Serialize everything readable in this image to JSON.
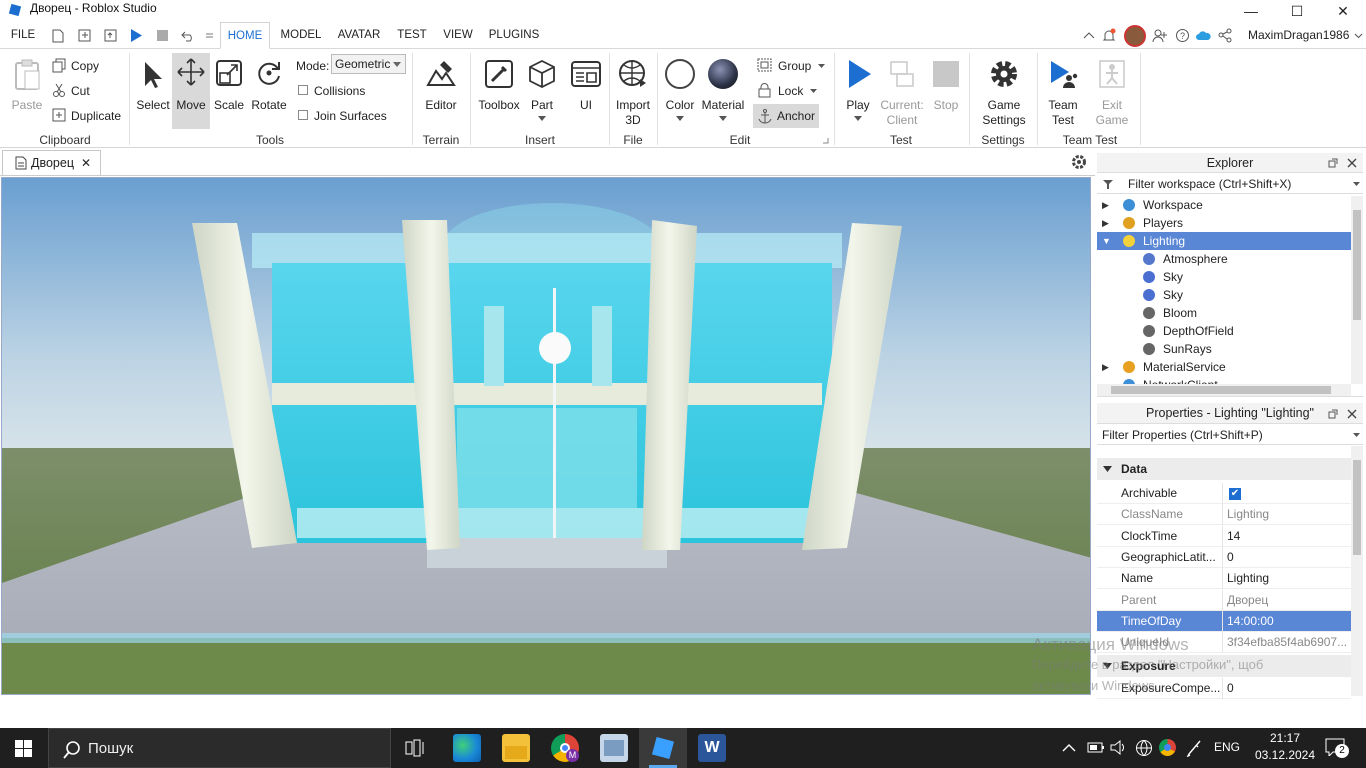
{
  "window": {
    "title": "Дворец - Roblox Studio",
    "minimize": "—",
    "maximize": "☐",
    "close": "✕"
  },
  "menu": {
    "tabs": [
      "FILE",
      "HOME",
      "MODEL",
      "AVATAR",
      "TEST",
      "VIEW",
      "PLUGINS"
    ],
    "active": "HOME",
    "username": "MaximDragan1986"
  },
  "ribbon": {
    "clipboard": {
      "paste": "Paste",
      "copy": "Copy",
      "cut": "Cut",
      "duplicate": "Duplicate",
      "group_label": "Clipboard"
    },
    "tools": {
      "select": "Select",
      "move": "Move",
      "scale": "Scale",
      "rotate": "Rotate",
      "mode_label": "Mode:",
      "mode_value": "Geometric",
      "collisions": "Collisions",
      "join_surfaces": "Join Surfaces",
      "group_label": "Tools"
    },
    "terrain": {
      "editor": "Editor",
      "group_label": "Terrain"
    },
    "insert": {
      "toolbox": "Toolbox",
      "part": "Part",
      "ui": "UI",
      "group_label": "Insert"
    },
    "file": {
      "import_line1": "Import",
      "import_line2": "3D",
      "group_label": "File"
    },
    "edit": {
      "color": "Color",
      "material": "Material",
      "group": "Group",
      "lock": "Lock",
      "anchor": "Anchor",
      "group_label": "Edit"
    },
    "test": {
      "play": "Play",
      "current_line1": "Current:",
      "current_line2": "Client",
      "stop": "Stop",
      "group_label": "Test"
    },
    "settings": {
      "game_line1": "Game",
      "game_line2": "Settings",
      "group_label": "Settings"
    },
    "team_test": {
      "team_line1": "Team",
      "team_line2": "Test",
      "exit_line1": "Exit",
      "exit_line2": "Game",
      "group_label": "Team Test"
    }
  },
  "document_tab": {
    "label": "Дворец",
    "close": "✕"
  },
  "explorer": {
    "title": "Explorer",
    "filter_placeholder": "Filter workspace (Ctrl+Shift+X)",
    "items": [
      {
        "label": "Workspace",
        "icon": "globe-icon"
      },
      {
        "label": "Players",
        "icon": "players-icon"
      },
      {
        "label": "Lighting",
        "icon": "bulb-icon"
      },
      {
        "label": "Atmosphere",
        "icon": "atmosphere-icon"
      },
      {
        "label": "Sky",
        "icon": "sky-icon"
      },
      {
        "label": "Sky",
        "icon": "sky-icon"
      },
      {
        "label": "Bloom",
        "icon": "bloom-icon"
      },
      {
        "label": "DepthOfField",
        "icon": "dof-icon"
      },
      {
        "label": "SunRays",
        "icon": "sunrays-icon"
      },
      {
        "label": "MaterialService",
        "icon": "material-service-icon"
      },
      {
        "label": "NetworkClient",
        "icon": "network-icon"
      }
    ],
    "selected": "Lighting"
  },
  "properties": {
    "title": "Properties - Lighting \"Lighting\"",
    "filter_placeholder": "Filter Properties (Ctrl+Shift+P)",
    "section_data": "Data",
    "section_exposure": "Exposure",
    "rows": [
      {
        "key": "Archivable",
        "value": "✔"
      },
      {
        "key": "ClassName",
        "value": "Lighting"
      },
      {
        "key": "ClockTime",
        "value": "14"
      },
      {
        "key": "GeographicLatit...",
        "value": "0"
      },
      {
        "key": "Name",
        "value": "Lighting"
      },
      {
        "key": "Parent",
        "value": "Дворец"
      },
      {
        "key": "TimeOfDay",
        "value": "14:00:00"
      },
      {
        "key": "UniqueId",
        "value": "3f34efba85f4ab6907..."
      }
    ],
    "exposure_row": {
      "key": "ExposureCompe...",
      "value": "0"
    },
    "watermark_line1": "Активация Windows",
    "watermark_line2": "Перейдите в раздел \"Настройки\", щоб",
    "watermark_line3": "активувати Windows."
  },
  "taskbar": {
    "search_placeholder": "Пошук",
    "lang": "ENG",
    "time": "21:17",
    "date": "03.12.2024",
    "notifications": "2"
  },
  "colors": {
    "accent": "#1c6fd0",
    "selected_row": "#5a86d6",
    "taskbar": "#1f1f1f"
  }
}
